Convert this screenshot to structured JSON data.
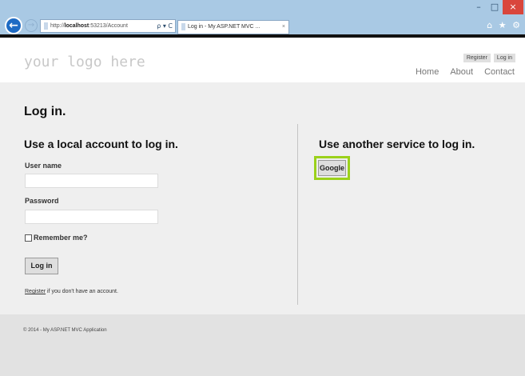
{
  "browser": {
    "window_controls": {
      "minimize": "–",
      "maximize": "□",
      "close": "×"
    },
    "back_icon": "←",
    "forward_icon": "→",
    "address": {
      "url_prefix": "http://",
      "url_host": "localhost",
      "url_rest": ":53213/Account",
      "tools": "ρ ▾ C"
    },
    "tab": {
      "title": "Log in - My ASP.NET MVC ...",
      "close": "×"
    },
    "right_icons": "⌂ ★ ⚙"
  },
  "header": {
    "logo_text": "your logo here",
    "register_label": "Register",
    "login_label": "Log in",
    "menu": [
      {
        "label": "Home"
      },
      {
        "label": "About"
      },
      {
        "label": "Contact"
      }
    ]
  },
  "main": {
    "page_title": "Log in.",
    "local": {
      "title": "Use a local account to log in.",
      "username_label": "User name",
      "username_value": "",
      "password_label": "Password",
      "password_value": "",
      "remember_label": "Remember me?",
      "login_button": "Log in",
      "register_link": "Register",
      "register_suffix": " if you don't have an account."
    },
    "external": {
      "title": "Use another service to log in.",
      "google_button": "Google"
    }
  },
  "footer": {
    "text": "© 2014 - My ASP.NET MVC Application"
  },
  "colors": {
    "highlight": "#9bd11b",
    "chrome": "#a9c9e4"
  }
}
